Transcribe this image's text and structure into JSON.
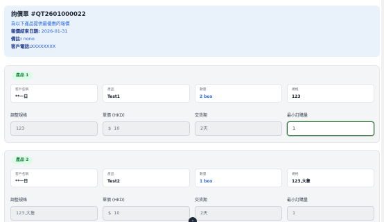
{
  "header": {
    "title": "詢價單 #QT2601000022",
    "subtitle": "為以下產品提供最優惠的報價",
    "deadline_label": "報價結束日期:",
    "deadline_value": "2026-01-31",
    "remark_label": "備註:",
    "remark_value": "nono",
    "phone_label": "客戶電話:",
    "phone_value": "XXXXXXXX"
  },
  "products": [
    {
      "badge": "產品 1",
      "info": [
        {
          "label": "客戶名稱",
          "value": "**一日"
        },
        {
          "label": "產品",
          "value": "Test1"
        },
        {
          "label": "數量",
          "value": "2 box"
        },
        {
          "label": "規格",
          "value": "123"
        }
      ],
      "fields": [
        {
          "label": "調整規格",
          "value": "123"
        },
        {
          "label": "單價 (HKD)",
          "prefix": "$",
          "value": "10"
        },
        {
          "label": "交貨期",
          "value": "2天"
        },
        {
          "label": "最小訂購量",
          "value": "1"
        }
      ]
    },
    {
      "badge": "產品 2",
      "info": [
        {
          "label": "客戶名稱",
          "value": "**一日"
        },
        {
          "label": "產品",
          "value": "Test2"
        },
        {
          "label": "數量",
          "value": "1 box"
        },
        {
          "label": "規格",
          "value": "123,大隻"
        }
      ],
      "fields": [
        {
          "label": "調整規格",
          "value": "123,大隻"
        },
        {
          "label": "單價 (HKD)",
          "prefix": "$",
          "value": "10"
        },
        {
          "label": "交貨期",
          "value": "2天"
        },
        {
          "label": "最小訂購量",
          "value": "1"
        }
      ]
    }
  ],
  "scroll_button": {
    "icon": "chevron-down-icon",
    "glyph": "⌄"
  }
}
